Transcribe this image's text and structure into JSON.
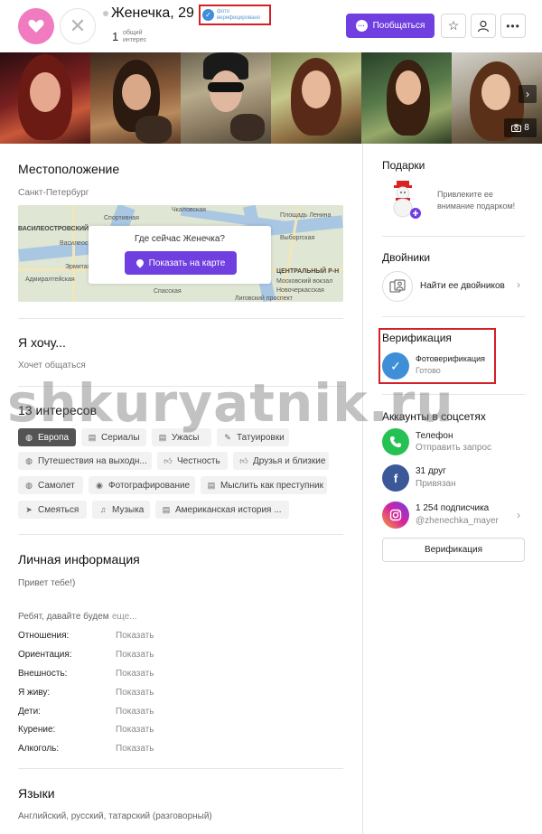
{
  "header": {
    "name": "Женечка, 29",
    "verify_badge_line1": "фото",
    "verify_badge_line2": "верифицировано",
    "common_count": "1",
    "common_label_line1": "общий",
    "common_label_line2": "интерес",
    "chat_button": "Пообщаться"
  },
  "photos": {
    "count": "8"
  },
  "location": {
    "title": "Местоположение",
    "city": "Санкт-Петербург",
    "map_question": "Где сейчас Женечка?",
    "map_button": "Показать на карте",
    "map_labels": [
      "ВАСИЛЕОСТРОВСКИЙ Р-Н",
      "Спортивная",
      "Василеостровская",
      "Эрмитаж",
      "Адмиралтейская",
      "Спасская",
      "Лиговский проспект",
      "Новочеркасская",
      "Московский вокзал",
      "ЦЕНТРАЛЬНЫЙ Р-Н",
      "Площадь Ленина",
      "Чкаловская",
      "Выборгская"
    ]
  },
  "wants": {
    "title": "Я хочу...",
    "value": "Хочет общаться"
  },
  "interests": {
    "title": "13 интересов",
    "items": [
      {
        "icon": "globe",
        "label": "Европа",
        "active": true
      },
      {
        "icon": "film",
        "label": "Сериалы",
        "active": false
      },
      {
        "icon": "film",
        "label": "Ужасы",
        "active": false
      },
      {
        "icon": "tattoo",
        "label": "Татуировки",
        "active": false
      },
      {
        "icon": "globe",
        "label": "Путешествия на выходн...",
        "active": false
      },
      {
        "icon": "thumb",
        "label": "Честность",
        "active": false
      },
      {
        "icon": "thumb",
        "label": "Друзья и близкие",
        "active": false
      },
      {
        "icon": "globe",
        "label": "Самолет",
        "active": false
      },
      {
        "icon": "camera",
        "label": "Фотографирование",
        "active": false
      },
      {
        "icon": "film",
        "label": "Мыслить как преступник",
        "active": false
      },
      {
        "icon": "plane",
        "label": "Смеяться",
        "active": false
      },
      {
        "icon": "music",
        "label": "Музыка",
        "active": false
      },
      {
        "icon": "film",
        "label": "Американская история ...",
        "active": false
      }
    ]
  },
  "personal": {
    "title": "Личная информация",
    "greeting": "Привет тебе!)",
    "intro": "Ребят, давайте будем",
    "more": "еще...",
    "rows": [
      {
        "label": "Отношения:",
        "value": "Показать"
      },
      {
        "label": "Ориентация:",
        "value": "Показать"
      },
      {
        "label": "Внешность:",
        "value": "Показать"
      },
      {
        "label": "Я живу:",
        "value": "Показать"
      },
      {
        "label": "Дети:",
        "value": "Показать"
      },
      {
        "label": "Курение:",
        "value": "Показать"
      },
      {
        "label": "Алкоголь:",
        "value": "Показать"
      }
    ]
  },
  "languages": {
    "title": "Языки",
    "value": "Английский, русский, татарский (разговорный)"
  },
  "gifts": {
    "title": "Подарки",
    "text": "Привлеките ее внимание подарком!"
  },
  "twins": {
    "title": "Двойники",
    "text": "Найти ее двойников"
  },
  "verification": {
    "title": "Верификация",
    "item": "Фотоверификация",
    "status": "Готово"
  },
  "social": {
    "title": "Аккаунты в соцсетях",
    "phone_label": "Телефон",
    "phone_action": "Отправить запрос",
    "fb_label": "31 друг",
    "fb_status": "Привязан",
    "ig_label": "1 254 подписчика",
    "ig_handle": "@zhenechka_mayer",
    "verify_button": "Верификация"
  },
  "watermark": "shkuryatnik.ru",
  "colors": {
    "accent": "#6f3fe0",
    "like": "#f07bc0",
    "verify": "#3e8fd8",
    "highlight": "#d42027",
    "whatsapp": "#25c153",
    "facebook": "#3b5998",
    "instagram": "#d6249f"
  }
}
